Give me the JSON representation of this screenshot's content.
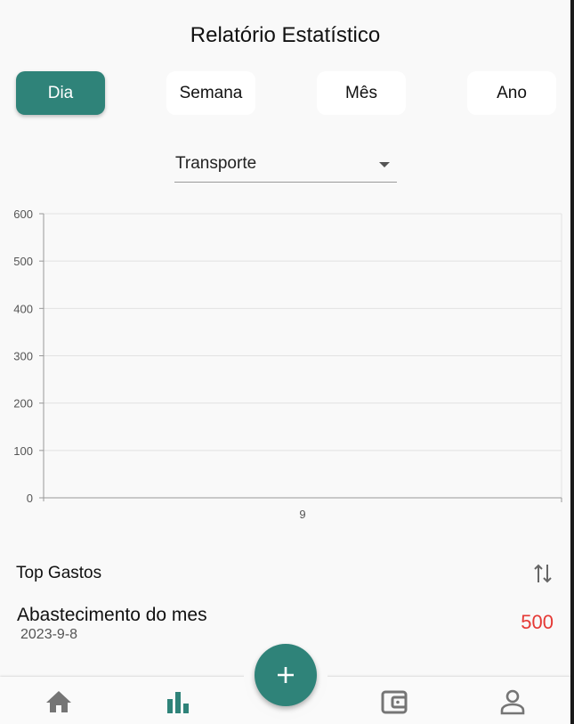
{
  "header": {
    "title": "Relatório Estatístico"
  },
  "period_tabs": [
    {
      "label": "Dia",
      "active": true
    },
    {
      "label": "Semana",
      "active": false
    },
    {
      "label": "Mês",
      "active": false
    },
    {
      "label": "Ano",
      "active": false
    }
  ],
  "category_select": {
    "value": "Transporte"
  },
  "chart_data": {
    "type": "bar",
    "categories": [
      "9"
    ],
    "values": [
      0
    ],
    "ylim": [
      0,
      600
    ],
    "yticks": [
      "0",
      "100",
      "200",
      "300",
      "400",
      "500",
      "600"
    ],
    "xlabel": "",
    "ylabel": "",
    "grid": true
  },
  "top_expenses": {
    "title": "Top Gastos",
    "sort_icon": "sort-arrows-icon",
    "items": [
      {
        "title": "Abastecimento do mes",
        "date": "2023-9-8",
        "amount": "500"
      }
    ]
  },
  "colors": {
    "accent": "#2f8379",
    "amount": "#e53935"
  },
  "bottom_nav": {
    "items": [
      {
        "icon": "home-icon",
        "active": false
      },
      {
        "icon": "bar-chart-icon",
        "active": true
      },
      {
        "icon": "wallet-icon",
        "active": false
      },
      {
        "icon": "user-icon",
        "active": false
      }
    ],
    "fab_icon": "plus-icon"
  }
}
